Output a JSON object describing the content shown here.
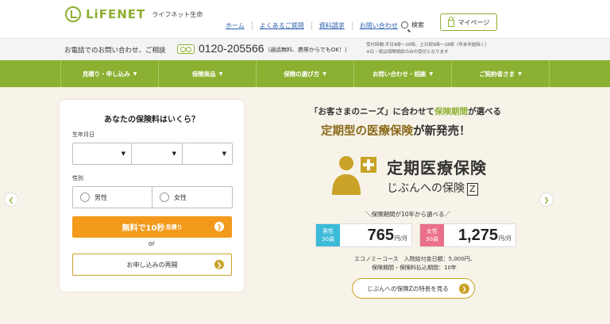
{
  "header": {
    "logo_text": "LiFENET",
    "logo_sub": "ライフネット生命",
    "nav": [
      "ホーム",
      "よくあるご質問",
      "資料請求",
      "お問い合わせ"
    ],
    "search_label": "検索",
    "mypage_label": "マイページ"
  },
  "phonebar": {
    "lead": "お電話でのお問い合わせ、ご相談",
    "number": "0120-205566",
    "note": "（通話無料、携帯からでもOK！）",
    "hours_line1": "受付時間:平日9時〜20時、土日祝9時〜18時（年末年始除く）",
    "hours_line2": "※日・祝は保険相談のみの受付となります"
  },
  "mainnav": [
    "見積り・申し込み",
    "保険商品",
    "保険の選び方",
    "お問い合わせ・相談",
    "ご契約者さま"
  ],
  "form": {
    "title": "あなたの保険料はいくら？",
    "birth_label": "生年月日",
    "gender_label": "性別",
    "male": "男性",
    "female": "女性",
    "quote_main": "無料で10秒",
    "quote_small": "見積り",
    "or": "or",
    "resume": "お申し込みの再開"
  },
  "promo": {
    "line1_pre": "「お客さまのニーズ」に合わせて",
    "line1_hl": "保険期間",
    "line1_post": "が選べる",
    "line2_pre": "定期型",
    "line2_mid": "の医療保険",
    "line2_post": "が新発売！",
    "product_title": "定期医療保険",
    "product_sub": "じぶんへの保険",
    "product_z": "Z",
    "period": "＼保険期間が10年から選べる／",
    "male_tag": "男性\n30歳",
    "male_price": "765",
    "female_tag": "女性\n30歳",
    "female_price": "1,275",
    "unit": "円/月",
    "econ_line1": "エコノミーコース　入院給付金日額：5,000円、",
    "econ_line2": "保険期間・保険料払込期間：10年",
    "feature_btn": "じぶんへの保険Zの特長を見る"
  },
  "colors": {
    "brand_green": "#8cb031",
    "orange": "#f39a1c",
    "gold": "#c9a227",
    "male_tag": "#3bbbd8",
    "female_tag": "#ea6f8a"
  }
}
